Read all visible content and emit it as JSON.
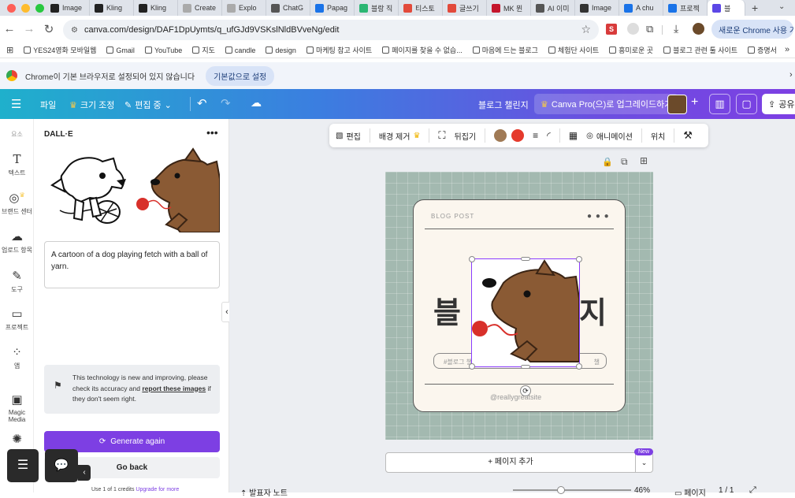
{
  "browser": {
    "tabs": [
      {
        "label": "Image",
        "color": "#222"
      },
      {
        "label": "Kling",
        "color": "#222"
      },
      {
        "label": "Kling",
        "color": "#222"
      },
      {
        "label": "Create",
        "color": "#aaa"
      },
      {
        "label": "Explo",
        "color": "#aaa"
      },
      {
        "label": "ChatG",
        "color": "#555"
      },
      {
        "label": "Papag",
        "color": "#1a73e8"
      },
      {
        "label": "블랑 직",
        "color": "#2bb673"
      },
      {
        "label": "티스토",
        "color": "#e24a3b"
      },
      {
        "label": "글쓰기",
        "color": "#e24a3b"
      },
      {
        "label": "MK 뮌",
        "color": "#c4152b"
      },
      {
        "label": "AI 이미",
        "color": "#555"
      },
      {
        "label": "Image",
        "color": "#333"
      },
      {
        "label": "A chu",
        "color": "#1a73e8"
      },
      {
        "label": "프로젝",
        "color": "#1a73e8"
      },
      {
        "label": "블",
        "color": "#5c47e6"
      }
    ],
    "url": "canva.com/design/DAF1DpUymts/q_ufGJd9VSKslNldBVveNg/edit",
    "chrome_button": "새로운 Chrome 사용 가능",
    "bookmarks": [
      "YES24영화 모바일웹",
      "Gmail",
      "YouTube",
      "지도",
      "candle",
      "design",
      "마케팅 참고 사이트",
      "페이지를 찾을 수 없습...",
      "마음에 드는 블로그",
      "체험단 사이트",
      "흥미로운 곳",
      "블로그 관련 툴 사이트",
      "증명서"
    ],
    "infobar_text": "Chrome이 기본 브라우저로 설정되어 있지 않습니다",
    "infobar_button": "기본값으로 설정"
  },
  "canva_header": {
    "file": "파일",
    "resize": "크기 조정",
    "editing": "편집 중",
    "doc_title": "블로그 챌린지",
    "upgrade": "Canva Pro(으)로 업그레이드하기",
    "share": "공유"
  },
  "rail": [
    {
      "label": "요소",
      "icon": "elements-icon"
    },
    {
      "label": "텍스트",
      "icon": "text-icon"
    },
    {
      "label": "브랜드 센터",
      "icon": "brand-icon"
    },
    {
      "label": "업로드 항목",
      "icon": "upload-icon"
    },
    {
      "label": "도구",
      "icon": "draw-icon"
    },
    {
      "label": "프로젝트",
      "icon": "folder-icon"
    },
    {
      "label": "앱",
      "icon": "apps-icon"
    },
    {
      "label": "Magic Media",
      "icon": "magic-media-icon"
    }
  ],
  "panel": {
    "title": "DALL·E",
    "prompt": "A cartoon of a dog playing fetch with a ball of yarn.",
    "notice": "This technology is new and improving, please check its accuracy and ",
    "notice_link": "report these images",
    "notice_tail": " if they don't seem right.",
    "generate_again": "Generate again",
    "go_back": "Go back",
    "credits": "Use 1 of 1 credits",
    "upgrade_more": "Upgrade for more"
  },
  "toolbar": {
    "edit": "편집",
    "remove_bg": "배경 제거",
    "flip": "뒤집기",
    "animate": "애니메이션",
    "position": "위치",
    "colors": [
      "#a07a55",
      "#e53a2c"
    ]
  },
  "design": {
    "blog_post": "BLOG POST",
    "title_left": "블",
    "title_right": "지",
    "hashtag": "#블로그 챌",
    "hashtag_right": "챌",
    "footer": "@reallygreatsite",
    "bg_color": "#a3b9b0",
    "card_color": "#fbf6ee"
  },
  "footer": {
    "add_page": "+ 페이지 추가",
    "new_badge": "New",
    "notes": "발표자 노트",
    "zoom": "46%",
    "page_label": "페이지",
    "page_count": "1 / 1"
  }
}
